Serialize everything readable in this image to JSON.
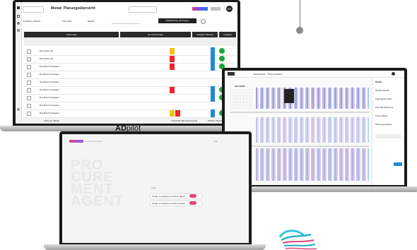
{
  "adpilot_label": {
    "bold": "AD",
    "rest": "pilot"
  },
  "laptop1": {
    "title": "Monat: Planungsübersicht",
    "user_initials": "ER",
    "filter_1": "KUNDEN: GTEAM",
    "filter_2": "FILIALEN",
    "filter_3": "MEDIA",
    "toolbar_button": "Marktprüfung übertragen",
    "sections": [
      "Kultur-Grid",
      "On Pixel Portale",
      "Freigabe Planung",
      "Freigabe Bildauswahl"
    ],
    "row_labels": [
      "Das Haus Lilie",
      "Das Haus Lilie",
      "Das Bosch & Regent",
      "Das Bosch & Regent",
      "Das Bosch & Regent",
      "Das Bosch & Regent",
      "Das Bosch & Regent",
      "Das Bosch & Regent",
      "Das Bosch & Regent"
    ],
    "footer_left": "Sortieren Filtrate",
    "footer_right_1": "Freischalt Planungsvorgang",
    "footer_right_2": "Filtration Berechnung"
  },
  "laptop2": {
    "title": "Zeitbausteine · Planungsstatus",
    "calendar_month": "April 2023",
    "panel_title": "Details",
    "panel_items": [
      "Mediaauswahl",
      "Kampagnen-Start",
      "Prio-Überarbeitung",
      "Preis-Aufbau",
      "Planungsvorgang"
    ]
  },
  "laptop3": {
    "brand": "procurement agent",
    "top_right": "Help",
    "big_words": [
      "PRO",
      "CURE",
      "MENT",
      "AGENT"
    ],
    "prompt": "Hallo",
    "actions": [
      "Create a requirement with AI agent",
      "Create a requirement with template"
    ]
  },
  "colors": {
    "accent_pink": "#e0447d",
    "accent_red": "#e8262b",
    "accent_yellow": "#f2c318",
    "accent_blue": "#1f8bd6",
    "accent_green": "#19a53c"
  }
}
